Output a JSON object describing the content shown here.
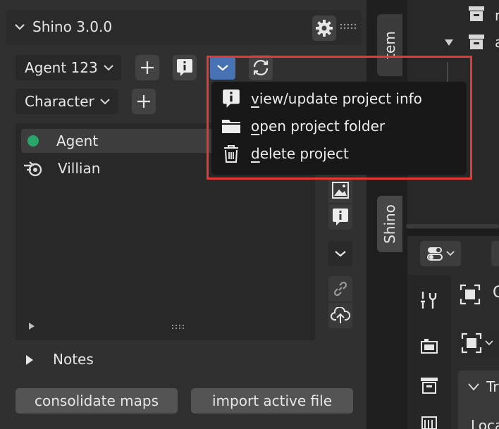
{
  "panel": {
    "title": "Shino 3.0.0",
    "project_dropdown": {
      "value": "Agent 123"
    },
    "category_dropdown": {
      "value": "Character"
    },
    "items": [
      {
        "label": "Agent",
        "icon": "green-dot-icon"
      },
      {
        "label": "Villian",
        "icon": "blender-icon"
      }
    ],
    "notes_label": "Notes",
    "consolidate_label": "consolidate maps",
    "import_label": "import active file"
  },
  "tabs": {
    "item_partial": "tem",
    "shino": "Shino"
  },
  "right": {
    "outliner_partial_1": "n",
    "outliner_partial_2": "a",
    "properties_partial_1": "C",
    "properties_partial_2": "Tr",
    "properties_partial_3": "Loca"
  },
  "menu": {
    "items": [
      {
        "first": "v",
        "rest": "iew/update project info",
        "icon": "info-icon"
      },
      {
        "first": "o",
        "rest": "pen project folder",
        "icon": "folder-icon"
      },
      {
        "first": "d",
        "rest": "elete project",
        "icon": "trash-icon"
      }
    ]
  },
  "colors": {
    "highlight": "#e53935",
    "accent_blue": "#4772b3",
    "active_green": "#27a86a"
  }
}
